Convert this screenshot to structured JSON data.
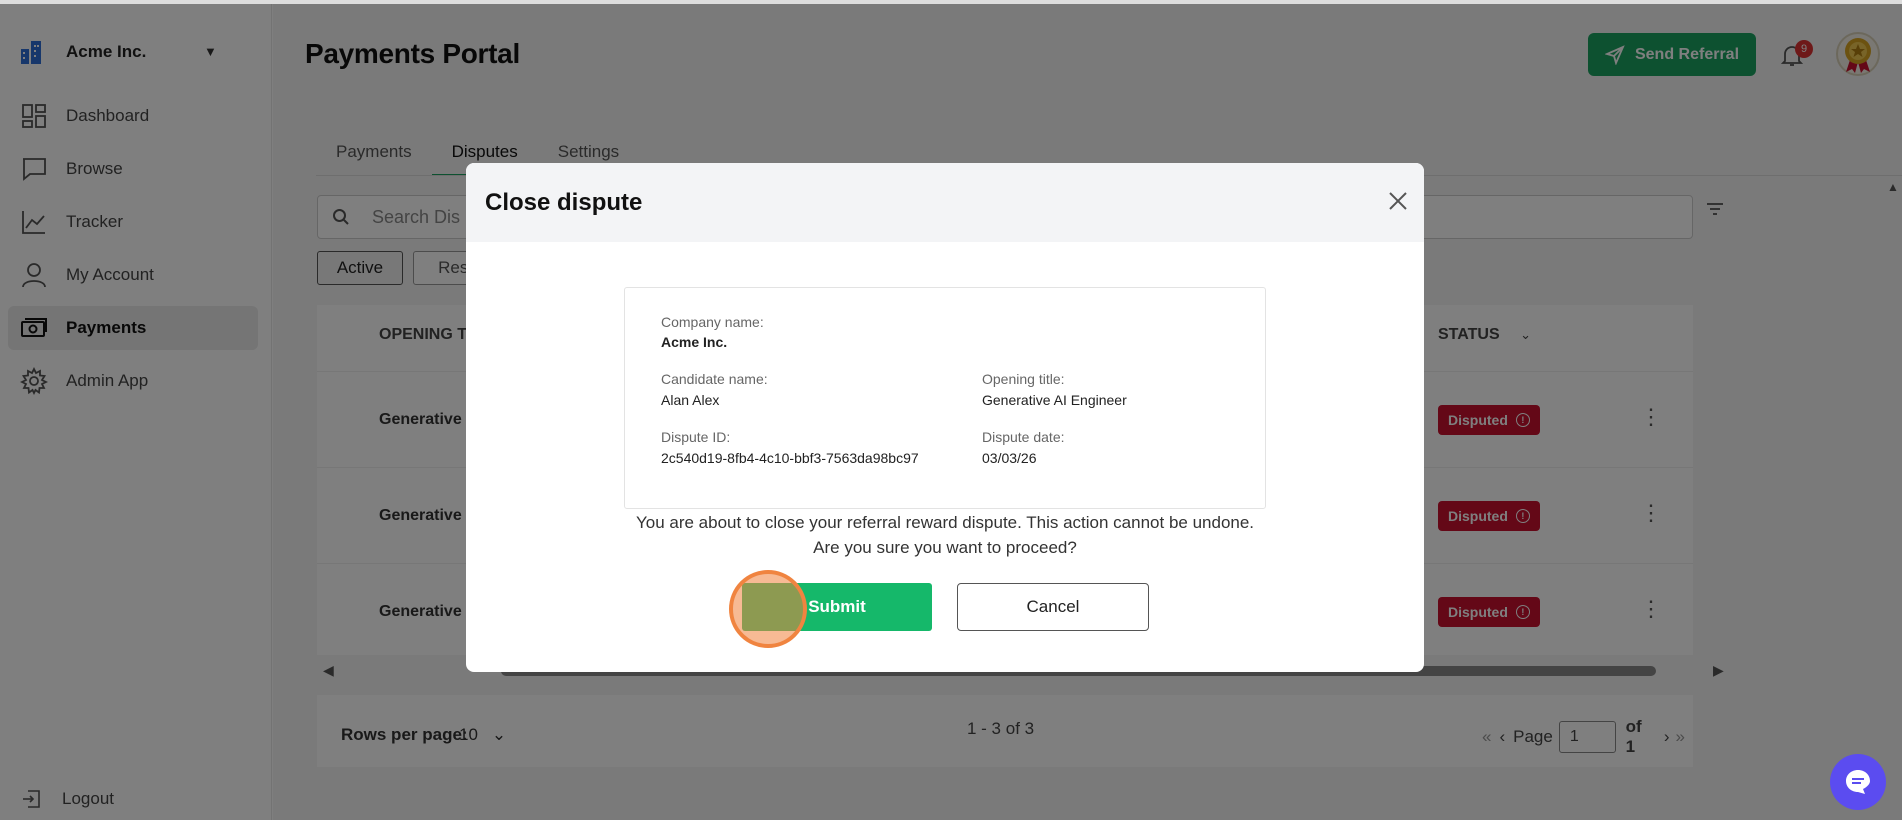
{
  "sidebar": {
    "company": "Acme Inc.",
    "items": [
      {
        "label": "Dashboard",
        "icon": "dashboard-icon"
      },
      {
        "label": "Browse",
        "icon": "chat-square-icon"
      },
      {
        "label": "Tracker",
        "icon": "trend-chart-icon"
      },
      {
        "label": "My Account",
        "icon": "user-icon"
      },
      {
        "label": "Payments",
        "icon": "money-icon"
      },
      {
        "label": "Admin App",
        "icon": "gear-icon"
      }
    ],
    "active_item": "Payments",
    "logout_label": "Logout"
  },
  "header": {
    "title": "Payments Portal",
    "send_referral_label": "Send Referral",
    "notification_count": "9"
  },
  "tabs": [
    {
      "label": "Payments"
    },
    {
      "label": "Disputes"
    },
    {
      "label": "Settings"
    }
  ],
  "active_tab": "Disputes",
  "search": {
    "placeholder": "Search Dis"
  },
  "filters": {
    "active_label": "Active",
    "resolved_label": "Reso"
  },
  "table": {
    "columns": {
      "opening_title": "OPENING T",
      "status": "STATUS"
    },
    "rows": [
      {
        "title": "Generative",
        "status": "Disputed"
      },
      {
        "title": "Generative",
        "status": "Disputed"
      },
      {
        "title": "Generative",
        "status": "Disputed"
      }
    ]
  },
  "footer": {
    "rows_per_page_label": "Rows per page:",
    "rows_per_page_value": "10",
    "range_text": "1 - 3 of 3",
    "page_label": "Page",
    "page_value": "1",
    "of_label": "of 1"
  },
  "modal": {
    "title": "Close dispute",
    "company_label": "Company name:",
    "company_value": "Acme Inc.",
    "candidate_label": "Candidate name:",
    "candidate_value": "Alan Alex",
    "opening_label": "Opening title:",
    "opening_value": "Generative AI Engineer",
    "dispute_id_label": "Dispute ID:",
    "dispute_id_value": "2c540d19-8fb4-4c10-bbf3-7563da98bc97",
    "dispute_date_label": "Dispute date:",
    "dispute_date_value": "03/03/26",
    "confirm_line1": "You are about to close your referral reward dispute. This action cannot be undone.",
    "confirm_line2": "Are you sure you want to proceed?",
    "submit_label": "Submit",
    "cancel_label": "Cancel"
  },
  "colors": {
    "accent_green": "#1aa260",
    "submit_green": "#15b86a",
    "disputed_red": "#c8102e",
    "chat_purple": "#5b4cf0"
  }
}
